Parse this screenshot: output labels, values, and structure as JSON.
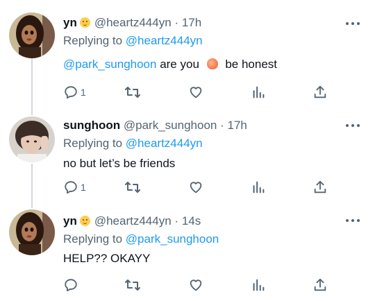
{
  "tweets": [
    {
      "name": "yn",
      "name_emoji": "upside-down-face-emoji",
      "handle": "@heartz444yn",
      "sep": "·",
      "time": "17h",
      "replying_prefix": "Replying to ",
      "replying_to": "@heartz444yn",
      "text_mention": "@park_sunghoon",
      "text_main": " are you ",
      "text_emoji": "peach-emoji",
      "text_end": " be honest",
      "reply_count": "1"
    },
    {
      "name": "sunghoon",
      "handle": "@park_sunghoon",
      "sep": "·",
      "time": "17h",
      "replying_prefix": "Replying to ",
      "replying_to": "@heartz444yn",
      "text": "no but let’s be friends",
      "reply_count": "1"
    },
    {
      "name": "yn",
      "name_emoji": "upside-down-face-emoji",
      "handle": "@heartz444yn",
      "sep": "·",
      "time": "14s",
      "replying_prefix": "Replying to ",
      "replying_to": "@park_sunghoon",
      "text": "HELP?? OKAYY",
      "reply_count": ""
    }
  ],
  "colors": {
    "link": "#1d9bf0",
    "secondary_text": "#536471",
    "primary_text": "#0f1419",
    "thread_line": "#cfd9de"
  },
  "icons": [
    "reply-icon",
    "retweet-icon",
    "like-icon",
    "analytics-icon",
    "share-icon",
    "more-icon"
  ]
}
